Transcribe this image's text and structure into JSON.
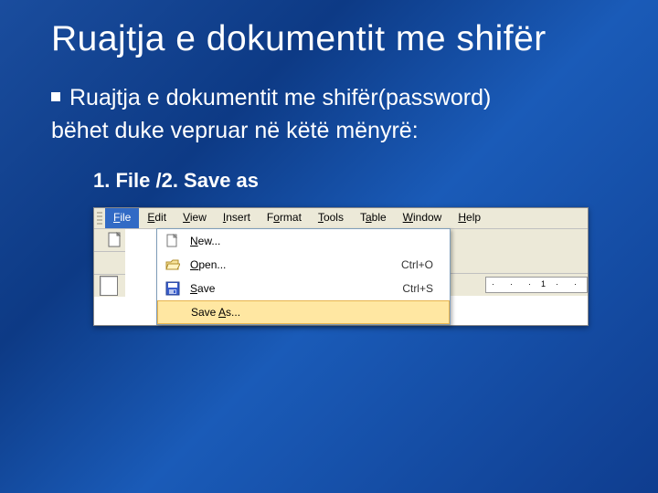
{
  "title": "Ruajtja e dokumentit me shifër",
  "body": {
    "line1": "Ruajtja e dokumentit me shifër(password)",
    "line2": "bëhet duke vepruar në këtë mënyrë:"
  },
  "step": "1. File /2. Save as",
  "menubar": {
    "file": "File",
    "edit": "Edit",
    "view": "View",
    "insert": "Insert",
    "format": "Format",
    "tools": "Tools",
    "table": "Table",
    "window": "Window",
    "help": "Help"
  },
  "dropdown": {
    "new": {
      "label": "New...",
      "shortcut": ""
    },
    "open": {
      "label": "Open...",
      "shortcut": "Ctrl+O"
    },
    "save": {
      "label": "Save",
      "shortcut": "Ctrl+S"
    },
    "saveas": {
      "label": "Save As...",
      "shortcut": ""
    }
  },
  "ruler_mark": "1"
}
